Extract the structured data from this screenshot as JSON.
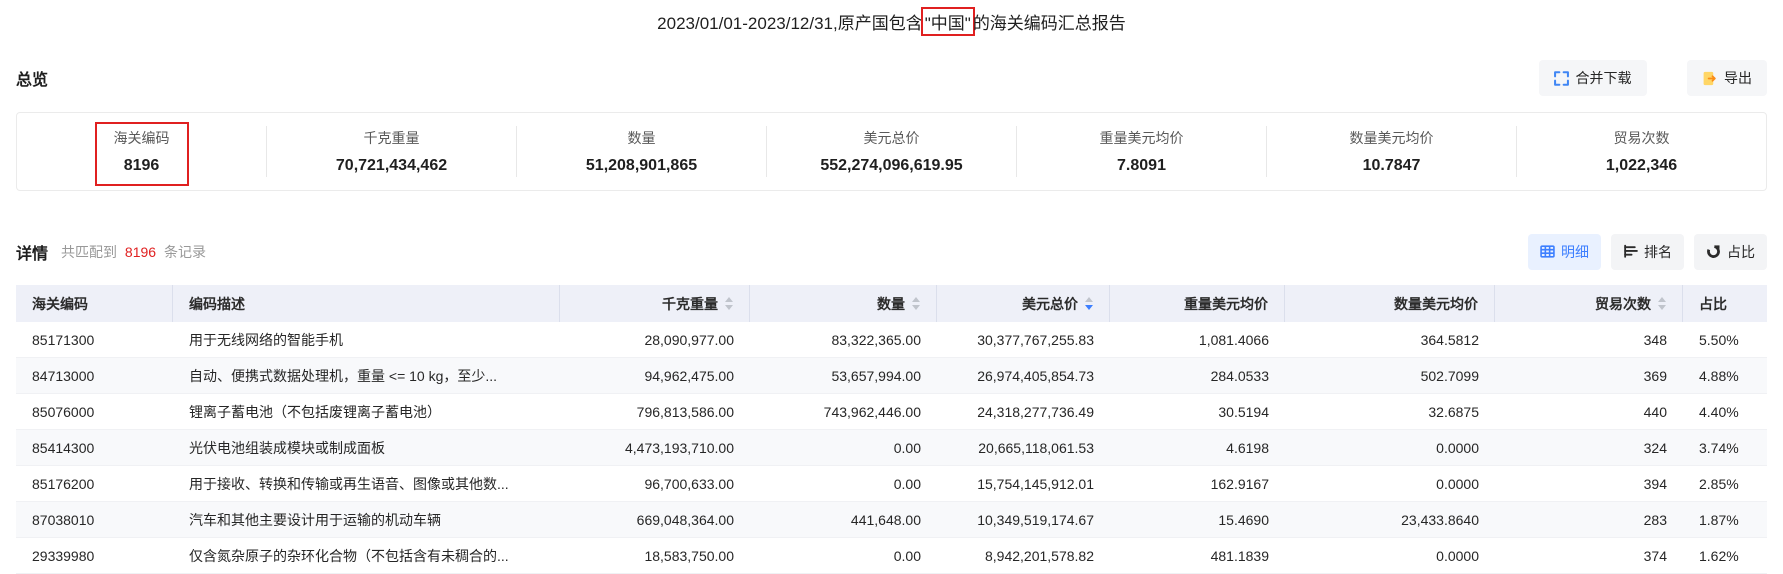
{
  "title": {
    "prefix": "2023/01/01-2023/12/31,原产国包含",
    "highlighted": "\"中国\"",
    "suffix": "的海关编码汇总报告"
  },
  "overview": {
    "heading": "总览",
    "merge_download_label": "合并下载",
    "export_label": "导出",
    "stats": [
      {
        "label": "海关编码",
        "value": "8196",
        "highlighted": true
      },
      {
        "label": "千克重量",
        "value": "70,721,434,462"
      },
      {
        "label": "数量",
        "value": "51,208,901,865"
      },
      {
        "label": "美元总价",
        "value": "552,274,096,619.95"
      },
      {
        "label": "重量美元均价",
        "value": "7.8091"
      },
      {
        "label": "数量美元均价",
        "value": "10.7847"
      },
      {
        "label": "贸易次数",
        "value": "1,022,346"
      }
    ]
  },
  "detail": {
    "heading": "详情",
    "match_prefix": "共匹配到",
    "match_count": "8196",
    "match_suffix": "条记录",
    "view_tabs": [
      {
        "name": "detail",
        "label": "明细",
        "icon": "table-icon",
        "active": true
      },
      {
        "name": "ranking",
        "label": "排名",
        "icon": "ranking-icon",
        "active": false
      },
      {
        "name": "proportion",
        "label": "占比",
        "icon": "donut-icon",
        "active": false
      }
    ]
  },
  "table": {
    "columns": [
      {
        "label": "海关编码",
        "align": "left",
        "sortable": false,
        "sort": null
      },
      {
        "label": "编码描述",
        "align": "left",
        "sortable": false,
        "sort": null
      },
      {
        "label": "千克重量",
        "align": "right",
        "sortable": true,
        "sort": null
      },
      {
        "label": "数量",
        "align": "right",
        "sortable": true,
        "sort": null
      },
      {
        "label": "美元总价",
        "align": "right",
        "sortable": true,
        "sort": "desc"
      },
      {
        "label": "重量美元均价",
        "align": "right",
        "sortable": false,
        "sort": null
      },
      {
        "label": "数量美元均价",
        "align": "right",
        "sortable": false,
        "sort": null
      },
      {
        "label": "贸易次数",
        "align": "right",
        "sortable": true,
        "sort": null
      },
      {
        "label": "占比",
        "align": "left",
        "sortable": false,
        "sort": null
      }
    ],
    "rows": [
      [
        "85171300",
        "用于无线网络的智能手机",
        "28,090,977.00",
        "83,322,365.00",
        "30,377,767,255.83",
        "1,081.4066",
        "364.5812",
        "348",
        "5.50%"
      ],
      [
        "84713000",
        "自动、便携式数据处理机，重量 <= 10 kg，至少...",
        "94,962,475.00",
        "53,657,994.00",
        "26,974,405,854.73",
        "284.0533",
        "502.7099",
        "369",
        "4.88%"
      ],
      [
        "85076000",
        "锂离子蓄电池（不包括废锂离子蓄电池）",
        "796,813,586.00",
        "743,962,446.00",
        "24,318,277,736.49",
        "30.5194",
        "32.6875",
        "440",
        "4.40%"
      ],
      [
        "85414300",
        "光伏电池组装成模块或制成面板",
        "4,473,193,710.00",
        "0.00",
        "20,665,118,061.53",
        "4.6198",
        "0.0000",
        "324",
        "3.74%"
      ],
      [
        "85176200",
        "用于接收、转换和传输或再生语音、图像或其他数...",
        "96,700,633.00",
        "0.00",
        "15,754,145,912.01",
        "162.9167",
        "0.0000",
        "394",
        "2.85%"
      ],
      [
        "87038010",
        "汽车和其他主要设计用于运输的机动车辆",
        "669,048,364.00",
        "441,648.00",
        "10,349,519,174.67",
        "15.4690",
        "23,433.8640",
        "283",
        "1.87%"
      ],
      [
        "29339980",
        "仅含氮杂原子的杂环化合物（不包括含有未稠合的...",
        "18,583,750.00",
        "0.00",
        "8,942,201,578.82",
        "481.1839",
        "0.0000",
        "374",
        "1.62%"
      ]
    ]
  },
  "colors": {
    "annotation_red": "#e02020",
    "accent_blue": "#3d7fff",
    "icon_blue": "#4086f4",
    "export_yellow": "#ffd666",
    "export_orange": "#fa8c16",
    "header_bg": "#eef0f8",
    "stripe_bg": "#f8f9fb"
  }
}
